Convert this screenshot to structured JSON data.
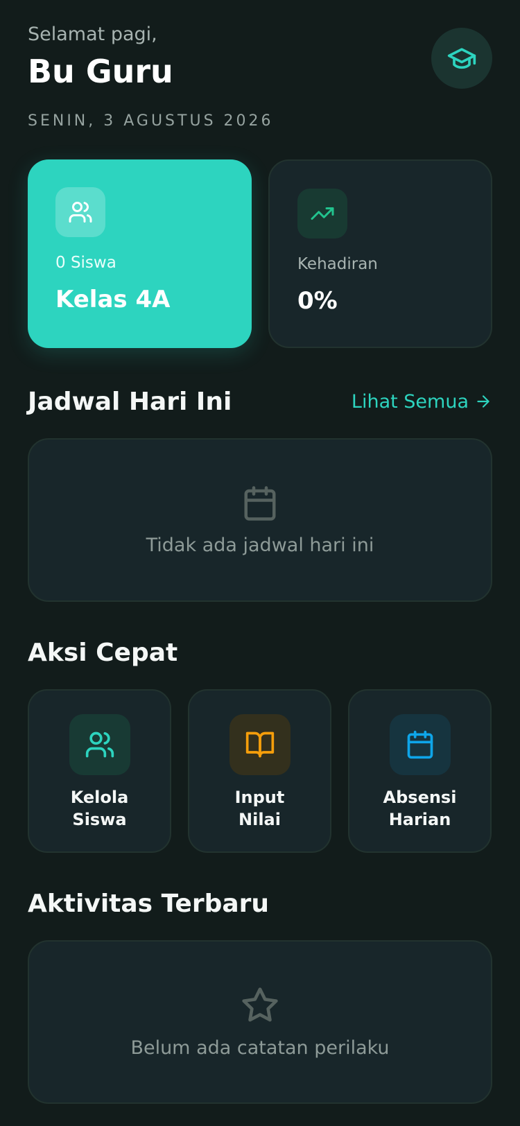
{
  "header": {
    "greeting": "Selamat pagi,",
    "name": "Bu Guru",
    "date": "SENIN, 3 AGUSTUS 2026",
    "avatar_icon": "graduation-cap-icon"
  },
  "stats": {
    "class_card": {
      "icon": "users-icon",
      "students": "0 Siswa",
      "class_name": "Kelas 4A"
    },
    "attendance_card": {
      "icon": "trending-up-icon",
      "label": "Kehadiran",
      "value": "0%"
    }
  },
  "schedule": {
    "title": "Jadwal Hari Ini",
    "see_all": "Lihat Semua",
    "empty_icon": "calendar-icon",
    "empty_text": "Tidak ada jadwal hari ini"
  },
  "quick_actions": {
    "title": "Aksi Cepat",
    "items": [
      {
        "line1": "Kelola",
        "line2": "Siswa",
        "icon": "users-icon",
        "color": "#2dd4bf"
      },
      {
        "line1": "Input",
        "line2": "Nilai",
        "icon": "book-open-icon",
        "color": "#f59e0b"
      },
      {
        "line1": "Absensi",
        "line2": "Harian",
        "icon": "calendar-icon",
        "color": "#0ea5e9"
      }
    ]
  },
  "activity": {
    "title": "Aktivitas Terbaru",
    "empty_icon": "star-icon",
    "empty_text": "Belum ada catatan perilaku"
  },
  "colors": {
    "background": "#121c1b",
    "accent": "#2dd4bf",
    "card": "#18262a"
  }
}
